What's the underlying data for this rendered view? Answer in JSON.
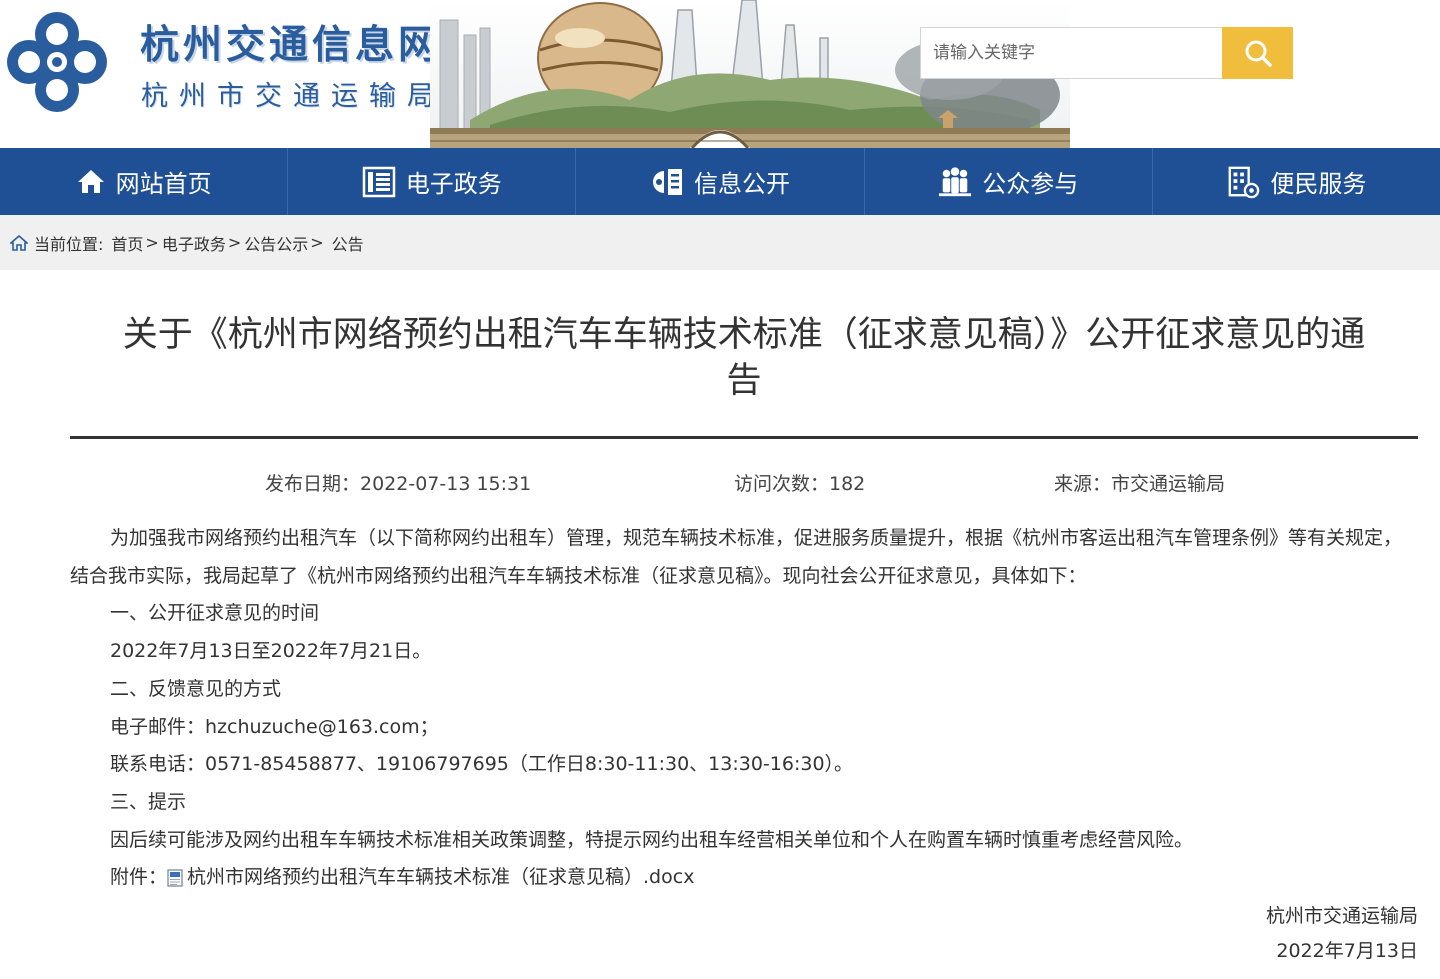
{
  "header": {
    "site_title": "杭州交通信息网",
    "site_subtitle": "杭州市交通运输局",
    "search_placeholder": "请输入关键字",
    "search_icon": "search-icon",
    "accent_color": "#f1bd3c",
    "brand_color": "#2a5d9e"
  },
  "nav": {
    "background": "#1f4f95",
    "items": [
      {
        "label": "网站首页",
        "icon": "home-icon"
      },
      {
        "label": "电子政务",
        "icon": "list-icon"
      },
      {
        "label": "信息公开",
        "icon": "info-board-icon"
      },
      {
        "label": "公众参与",
        "icon": "people-icon"
      },
      {
        "label": "便民服务",
        "icon": "service-building-icon"
      }
    ]
  },
  "breadcrumb": {
    "prefix": "当前位置:",
    "items": [
      "首页",
      "电子政务",
      "公告公示",
      "公告"
    ],
    "separator": ">"
  },
  "article": {
    "title": "关于《杭州市网络预约出租汽车车辆技术标准（征求意见稿）》公开征求意见的通告",
    "publish_date": "发布日期：2022-07-13 15:31",
    "visit_count": "访问次数：182",
    "source": "来源：市交通运输局",
    "paragraphs": [
      "为加强我市网络预约出租汽车（以下简称网约出租车）管理，规范车辆技术标准，促进服务质量提升，根据《杭州市客运出租汽车管理条例》等有关规定，结合我市实际，我局起草了《杭州市网络预约出租汽车车辆技术标准（征求意见稿》。现向社会公开征求意见，具体如下：",
      "一、公开征求意见的时间",
      "2022年7月13日至2022年7月21日。",
      "二、反馈意见的方式",
      "电子邮件：hzchuzuche@163.com；",
      "联系电话：0571-85458877、19106797695（工作日8:30-11:30、13:30-16:30）。",
      "三、提示",
      "因后续可能涉及网约出租车车辆技术标准相关政策调整，特提示网约出租车经营相关单位和个人在购置车辆时慎重考虑经营风险。"
    ],
    "attachment_label": "附件：",
    "attachment_name": "杭州市网络预约出租汽车车辆技术标准（征求意见稿）.docx",
    "attachment_icon": "word-doc-icon",
    "signature": "杭州市交通运输局",
    "sign_date": "2022年7月13日"
  }
}
